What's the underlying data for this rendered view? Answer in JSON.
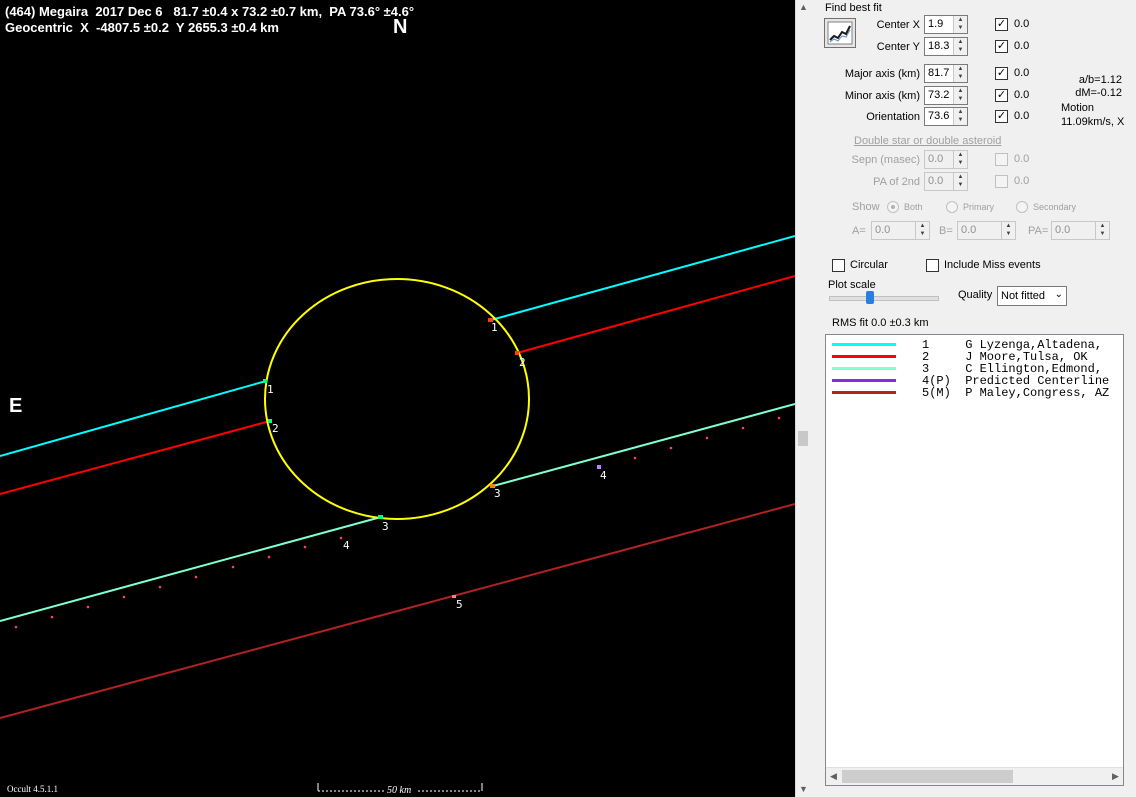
{
  "plot": {
    "title_line1": "(464) Megaira  2017 Dec 6   81.7 ±0.4 x 73.2 ±0.7 km,  PA 73.6° ±4.6°",
    "title_line2": "Geocentric  X  -4807.5 ±0.2  Y 2655.3 ±0.4 km",
    "north_label": "N",
    "east_label": "E",
    "version": "Occult 4.5.1.1",
    "scale_label": "50 km",
    "chord_labels": {
      "c1": "1",
      "c2": "2",
      "c3": "3",
      "c4": "4",
      "c5": "5"
    },
    "colors": {
      "background": "#000000",
      "ellipse": "#ffff00",
      "chord1": "#00ffff",
      "chord2": "#ff0000",
      "chord3": "#80ffd0",
      "chord4_predicted": "#8a2be2",
      "chord5_miss": "#b22222"
    }
  },
  "panel": {
    "find_best_fit": "Find best fit",
    "center_x": {
      "label": "Center X",
      "value": "1.9",
      "check_value": "0.0"
    },
    "center_y": {
      "label": "Center Y",
      "value": "18.3",
      "check_value": "0.0"
    },
    "major_axis": {
      "label": "Major axis (km)",
      "value": "81.7",
      "check_value": "0.0"
    },
    "minor_axis": {
      "label": "Minor axis (km)",
      "value": "73.2",
      "check_value": "0.0"
    },
    "orientation": {
      "label": "Orientation",
      "value": "73.6",
      "check_value": "0.0"
    },
    "ab_ratio": "a/b=1.12",
    "dm": "dM=-0.12",
    "motion_label": "Motion",
    "motion_value": "11.09km/s, X",
    "double_star": "Double star  or  double asteroid",
    "sepn": {
      "label": "Sepn (masec)",
      "value": "0.0",
      "check_value": "0.0"
    },
    "pa2nd": {
      "label": "PA of 2nd",
      "value": "0.0",
      "check_value": "0.0"
    },
    "show_label": "Show",
    "show_options": [
      "Both",
      "Primary",
      "Secondary"
    ],
    "a_label": "A=",
    "a_value": "0.0",
    "b_label": "B=",
    "b_value": "0.0",
    "pa_label": "PA=",
    "pa_value": "0.0",
    "circular_label": "Circular",
    "include_miss_label": "Include Miss events",
    "plot_scale_label": "Plot scale",
    "quality_label": "Quality",
    "quality_value": "Not fitted",
    "rms_fit": "RMS fit 0.0 ±0.3 km",
    "legend": [
      {
        "text": "1     G Lyzenga,Altadena,",
        "color": "#00ffff"
      },
      {
        "text": "2     J Moore,Tulsa, OK",
        "color": "#ff0000"
      },
      {
        "text": "3     C Ellington,Edmond,",
        "color": "#80ffd0"
      },
      {
        "text": "4(P)  Predicted Centerline",
        "color": "#8a2be2"
      },
      {
        "text": "5(M)  P Maley,Congress, AZ",
        "color": "#b22222"
      }
    ]
  }
}
